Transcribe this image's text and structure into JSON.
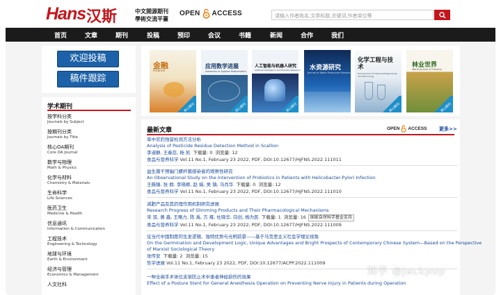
{
  "header": {
    "logo_en": "Hans",
    "logo_cn": "汉斯",
    "slogan_line1": "中文開源期刊",
    "slogan_line2": "學術交流平臺",
    "oa_left": "OPEN",
    "oa_right": "ACCESS",
    "search_placeholder": "请输入作者姓名,文章标题,关键词,作者单位等"
  },
  "nav": [
    "首页",
    "文章",
    "期刊",
    "投稿",
    "预印",
    "会议",
    "书籍",
    "新闻",
    "合作",
    "我们"
  ],
  "sidebar": {
    "buttons": [
      "欢迎投稿",
      "稿件跟踪"
    ],
    "heading": "学术期刊",
    "categories": [
      {
        "cn": "按学科分类",
        "en": "Journals by Subject"
      },
      {
        "cn": "按期刊分类",
        "en": "Journals by Title"
      },
      {
        "cn": "核心OA期刊",
        "en": "Core OA Journal"
      },
      {
        "cn": "数学与物理",
        "en": "Math & Physics"
      },
      {
        "cn": "化学与材料",
        "en": "Chemistry & Materials"
      },
      {
        "cn": "生命科学",
        "en": "Life Sciences"
      },
      {
        "cn": "医药卫生",
        "en": "Medicine & Health"
      },
      {
        "cn": "信息通讯",
        "en": "Information & Communication"
      },
      {
        "cn": "工程技术",
        "en": "Engineering & Technology"
      },
      {
        "cn": "地球与环境",
        "en": "Earth & Environment"
      },
      {
        "cn": "经济与管理",
        "en": "Economics & Management"
      },
      {
        "cn": "人文社科",
        "en": ""
      }
    ]
  },
  "covers": [
    {
      "title": "金融",
      "sub": "Finance",
      "badge": "核心期刊",
      "color": "#e9a14a"
    },
    {
      "title": "应用数学进展",
      "sub": "Advances in Applied Mathematics",
      "badge": "核心期刊",
      "color": "#3a6d9e"
    },
    {
      "title": "人工智能与机器人研究",
      "sub": "Artificial Intelligence and Robotics Research",
      "badge": "核心期刊",
      "color": "#2c4d86"
    },
    {
      "title": "水资源研究",
      "sub": "Journal of Water Resources Research",
      "badge": "",
      "color": "#1b5aa5"
    },
    {
      "title": "化学工程与技术",
      "sub": "Hans Journal of Chemical Engineering and Technology",
      "badge": "核心期刊",
      "color": "#7f9fc0"
    },
    {
      "title": "林业世界",
      "sub": "World Journal of Forestry",
      "badge": "核心期刊",
      "color": "#b2913f"
    }
  ],
  "articles_section": {
    "title": "最新文章",
    "oa_left": "OPEN",
    "oa_right": "ACCESS",
    "more": "更多>>"
  },
  "articles": [
    {
      "title_cn": "草中农药残留检测方法分析",
      "title_en": "Analysis of Pesticide Residue Detection Method in Scallion",
      "authors": "李淑静, 王春蕊, 杨 凯",
      "downloads": "下载量: 0",
      "views": "浏览量: 12",
      "journal": "食品与营养科学",
      "meta": "Vol.11 No.1, February 23 2022, PDF, DOI:10.12677/HJFNS.2022.111011",
      "fund": ""
    },
    {
      "title_cn": "益生菌干预幽门螺杆菌感染者的观察性研究",
      "title_en": "An Observational Study on the Intervention of Probiotics in Patients with Helicobacter-Pylori Infection",
      "authors": "王薇臻, 张 群, 李晓卿, 赵 娟, 吴 镇, 马肖华",
      "downloads": "下载量: 0",
      "views": "浏览量: 12",
      "journal": "食品与营养科学",
      "meta": "Vol.11 No.1, February 23 2022, PDF, DOI:10.12677/HJFNS.2022.111010",
      "fund": ""
    },
    {
      "title_cn": "减肥产品及其药理作用机制研究进展",
      "title_en": "Research Progress of Slimming Products and Their Pharmacological Mechanisms",
      "authors": "宋 双, 黄 鑫, 王略力, 陈 禹, 方 雍, 杜晓华, 向创, 杨为民",
      "downloads": "下载量: 1",
      "views": "浏览量: 16",
      "journal": "食品与营养科学",
      "meta": "Vol.11 No.1, February 23 2022, PDF, DOI:10.12677/HJFNS.2022.111009",
      "fund": "国家自然科学基金支持"
    },
    {
      "title_cn": "论当代中国制度的生发逻辑、独特优势与光明前景——基于马克思主义社会学理论视角",
      "title_en": "On the Germination and Development Logic, Unique Advantages and Bright Prospects of Contemporary Chinese System—Based on the Perspective",
      "title_en2": "of Marxist Sociological Theory",
      "authors": "张传安",
      "downloads": "下载量: 2",
      "views": "浏览量: 15",
      "journal": "哲学进展",
      "meta": "Vol.11 No.1, February 23 2022, PDF, DOI:10.12677/ACPP.2022.111009",
      "fund": ""
    },
    {
      "title_cn": "一种全麻手术体位支架防止术中患者神经损伤的效果",
      "title_en": "Effect of a Posture Stent for General Anesthesia Operation on Preventing Nerve Injury in Patients during Operation",
      "authors": "",
      "downloads": "",
      "views": "",
      "journal": "",
      "meta": "",
      "fund": ""
    }
  ],
  "watermark": "知乎 @Jackpop"
}
